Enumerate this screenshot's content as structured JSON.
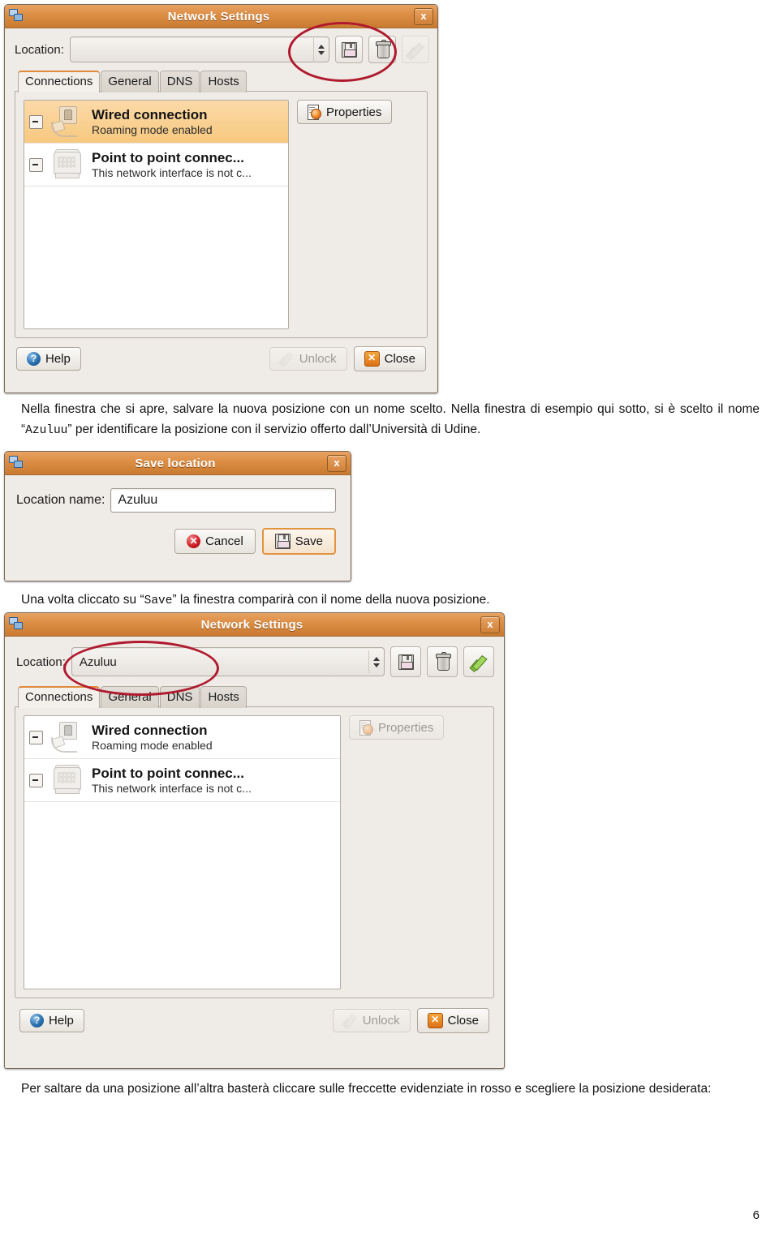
{
  "document": {
    "page_number": "6",
    "paragraph_1": "Nella finestra che si apre, salvare la nuova posizione con un nome scelto. Nella finestra di esempio qui sotto, si è scelto il nome “Azuluu” per identificare la posizione con il servizio offerto dall’Università di Udine.",
    "paragraph_1_a": "Nella finestra che si apre, salvare la nuova posizione con un nome scelto. Nella finestra di esempio qui sotto, si è scelto",
    "paragraph_1_b_pre": "il nome “",
    "paragraph_1_b_mono": "Azuluu",
    "paragraph_1_b_post": "” per identificare la posizione con il servizio offerto dall’Università di Udine.",
    "paragraph_2_pre": "Una volta cliccato su “",
    "paragraph_2_mono": "Save",
    "paragraph_2_post": "” la finestra comparirà con il nome della nuova posizione.",
    "paragraph_3": "Per saltare da una posizione all’altra basterà cliccare sulle freccette evidenziate in rosso e scegliere la posizione desiderata:"
  },
  "colors": {
    "titlebar_orange": "#dd8f45",
    "annotation_red": "#b01a2e",
    "selection_orange": "#f7c97f",
    "window_bg": "#efebe7"
  },
  "window_1": {
    "title": "Network Settings",
    "close_label": "x",
    "location_label": "Location:",
    "location_value": "",
    "toolbar": {
      "save_icon": "floppy-icon",
      "delete_icon": "trash-icon",
      "apply_icon": "check-icon",
      "apply_enabled": false
    },
    "tabs": [
      {
        "label": "Connections",
        "active": true
      },
      {
        "label": "General",
        "active": false
      },
      {
        "label": "DNS",
        "active": false
      },
      {
        "label": "Hosts",
        "active": false
      }
    ],
    "connections": [
      {
        "name": "Wired connection",
        "status": "Roaming mode enabled",
        "icon": "wired-connection-icon",
        "selected": true
      },
      {
        "name": "Point to point connec...",
        "status": "This network interface is not c...",
        "icon": "modem-connection-icon",
        "selected": false
      }
    ],
    "properties_label": "Properties",
    "properties_enabled": true,
    "buttons": {
      "help": "Help",
      "unlock": "Unlock",
      "unlock_enabled": false,
      "close": "Close"
    }
  },
  "window_2": {
    "title": "Save location",
    "close_label": "x",
    "field_label": "Location name:",
    "field_value": "Azuluu",
    "cancel_label": "Cancel",
    "save_label": "Save"
  },
  "window_3": {
    "title": "Network Settings",
    "close_label": "x",
    "location_label": "Location:",
    "location_value": "Azuluu",
    "toolbar": {
      "save_icon": "floppy-icon",
      "delete_icon": "trash-icon",
      "apply_icon": "check-icon",
      "apply_enabled": true
    },
    "tabs": [
      {
        "label": "Connections",
        "active": true
      },
      {
        "label": "General",
        "active": false
      },
      {
        "label": "DNS",
        "active": false
      },
      {
        "label": "Hosts",
        "active": false
      }
    ],
    "connections": [
      {
        "name": "Wired connection",
        "status": "Roaming mode enabled",
        "icon": "wired-connection-icon",
        "selected": false
      },
      {
        "name": "Point to point connec...",
        "status": "This network interface is not c...",
        "icon": "modem-connection-icon",
        "selected": false
      }
    ],
    "properties_label": "Properties",
    "properties_enabled": false,
    "buttons": {
      "help": "Help",
      "unlock": "Unlock",
      "unlock_enabled": false,
      "close": "Close"
    }
  }
}
